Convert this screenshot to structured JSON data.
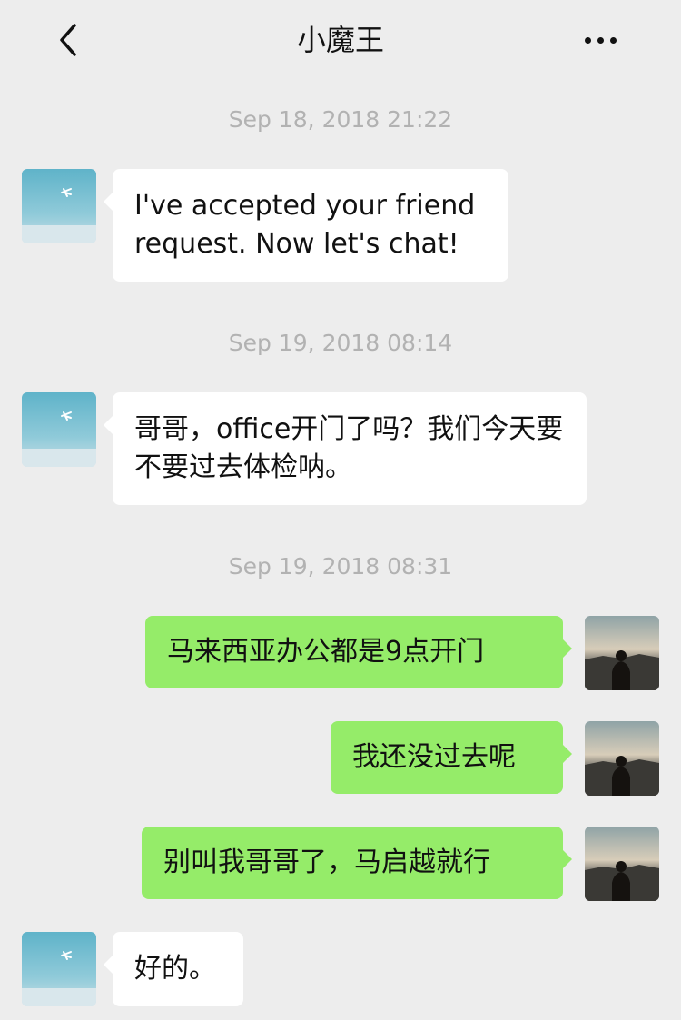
{
  "header": {
    "title": "小魔王"
  },
  "icons": {
    "back": "chevron-left-icon",
    "more": "more-dots-icon"
  },
  "conversation": {
    "timestamps": [
      "Sep 18, 2018 21:22",
      "Sep 19, 2018 08:14",
      "Sep 19, 2018 08:31"
    ],
    "messages": [
      {
        "sender": "contact",
        "text": "I've accepted your friend request. Now let's chat!"
      },
      {
        "sender": "contact",
        "text": "哥哥，office开门了吗？我们今天要不要过去体检呐。"
      },
      {
        "sender": "self",
        "text": "马来西亚办公都是9点开门"
      },
      {
        "sender": "self",
        "text": "我还没过去呢"
      },
      {
        "sender": "self",
        "text": "别叫我哥哥了，马启越就行"
      },
      {
        "sender": "contact",
        "text": "好的。"
      }
    ]
  },
  "colors": {
    "background": "#ededed",
    "incoming_bubble": "#ffffff",
    "outgoing_bubble": "#95ec69",
    "timestamp_text": "#b2b2b2"
  }
}
